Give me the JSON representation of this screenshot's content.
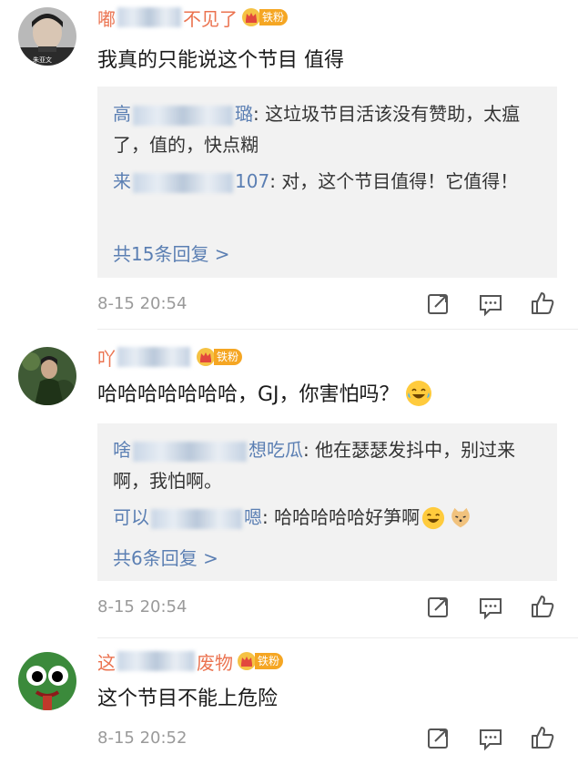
{
  "comments": [
    {
      "username_prefix": "嘟",
      "username_suffix": "不见了",
      "fan_badge": "铁粉",
      "text": "我真的只能说这个节目 值得",
      "avatar_caption": "朱亚文",
      "replies": [
        {
          "name_prefix": "高",
          "name_suffix": "璐",
          "text": ": 这垃圾节目活该没有赞助，太瘟了，值的，快点糊"
        },
        {
          "name_prefix": "来",
          "name_suffix": "107",
          "text": ": 对，这个节目值得！它值得！"
        }
      ],
      "more_replies": "共15条回复 >",
      "timestamp": "8-15 20:54"
    },
    {
      "username_prefix": "吖",
      "username_suffix": "",
      "fan_badge": "铁粉",
      "text": "哈哈哈哈哈哈哈，GJ，你害怕吗？",
      "replies": [
        {
          "name_prefix": "啥",
          "name_suffix": "想吃瓜",
          "text": ": 他在瑟瑟发抖中，别过来啊，我怕啊。"
        },
        {
          "name_prefix": "可以",
          "name_suffix": "嗯",
          "text": ": 哈哈哈哈哈好笋啊"
        }
      ],
      "more_replies": "共6条回复 >",
      "timestamp": "8-15 20:54"
    },
    {
      "username_prefix": "这",
      "username_suffix": "废物",
      "fan_badge": "铁粉",
      "text": "这个节目不能上危险",
      "timestamp": "8-15 20:52"
    }
  ],
  "icons": {
    "share": "share-icon",
    "comment": "comment-icon",
    "like": "thumbs-up-icon"
  },
  "colors": {
    "username": "#eb7350",
    "reply_name": "#5b7fb3",
    "reply_bg": "#f2f2f2",
    "meta": "#9a9a9a",
    "badge": "#f5a623"
  }
}
